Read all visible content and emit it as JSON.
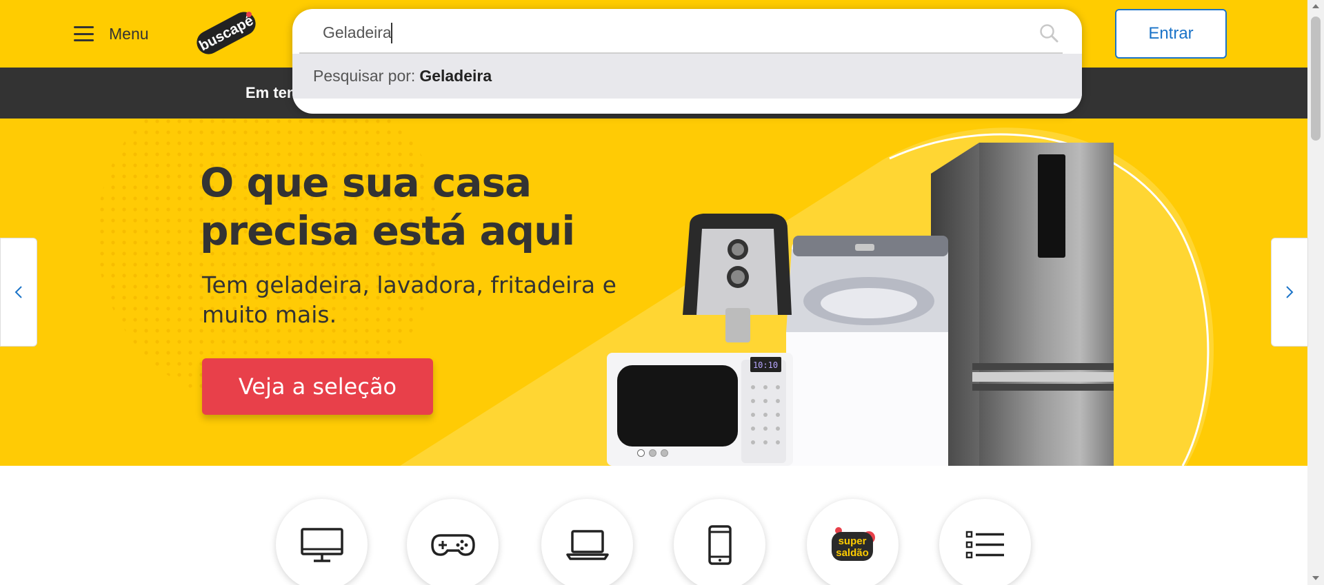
{
  "header": {
    "menu_label": "Menu",
    "logo_text": "buscapé",
    "enter_label": "Entrar",
    "colors": {
      "brand_yellow": "#ffcc00",
      "enter_blue": "#1a73c8"
    }
  },
  "navbar": {
    "visible_item": "Em ten"
  },
  "search": {
    "value": "Geladeira",
    "suggestion_prefix": "Pesquisar por:",
    "suggestion_term": "Geladeira"
  },
  "hero": {
    "title": "O que sua casa precisa está aqui",
    "subtitle": "Tem geladeira, lavadora, fritadeira e muito mais.",
    "cta_label": "Veja a seleção",
    "microwave_display": "10:10",
    "slides_total": 3,
    "active_slide": 1,
    "colors": {
      "background": "#ffcb05",
      "cta": "#e8404a"
    }
  },
  "categories": [
    {
      "icon": "tv-icon"
    },
    {
      "icon": "gamepad-icon"
    },
    {
      "icon": "laptop-icon"
    },
    {
      "icon": "smartphone-icon"
    },
    {
      "icon": "super-saldao-icon",
      "text_line1": "super",
      "text_line2": "saldão"
    },
    {
      "icon": "list-icon"
    }
  ]
}
